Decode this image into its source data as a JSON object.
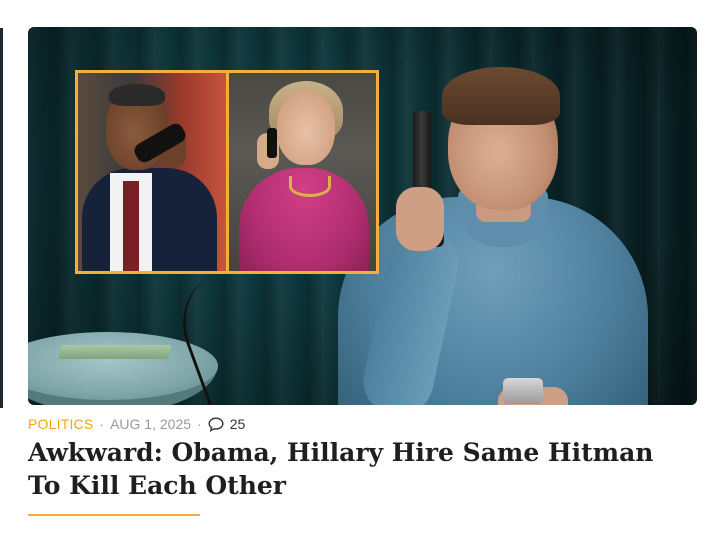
{
  "article": {
    "category": "POLITICS",
    "date": "AUG 1, 2025",
    "separator": "·",
    "comment_count": "25",
    "title": "Awkward: Obama, Hillary Hire Same Hitman To Kill Each Other",
    "excerpt": ""
  },
  "colors": {
    "accent": "#f2a30f",
    "title": "#1f1f1f",
    "meta": "#9a9a9a",
    "frame": "#f2b03a"
  },
  "icons": {
    "comment": "speech-bubble-icon"
  }
}
